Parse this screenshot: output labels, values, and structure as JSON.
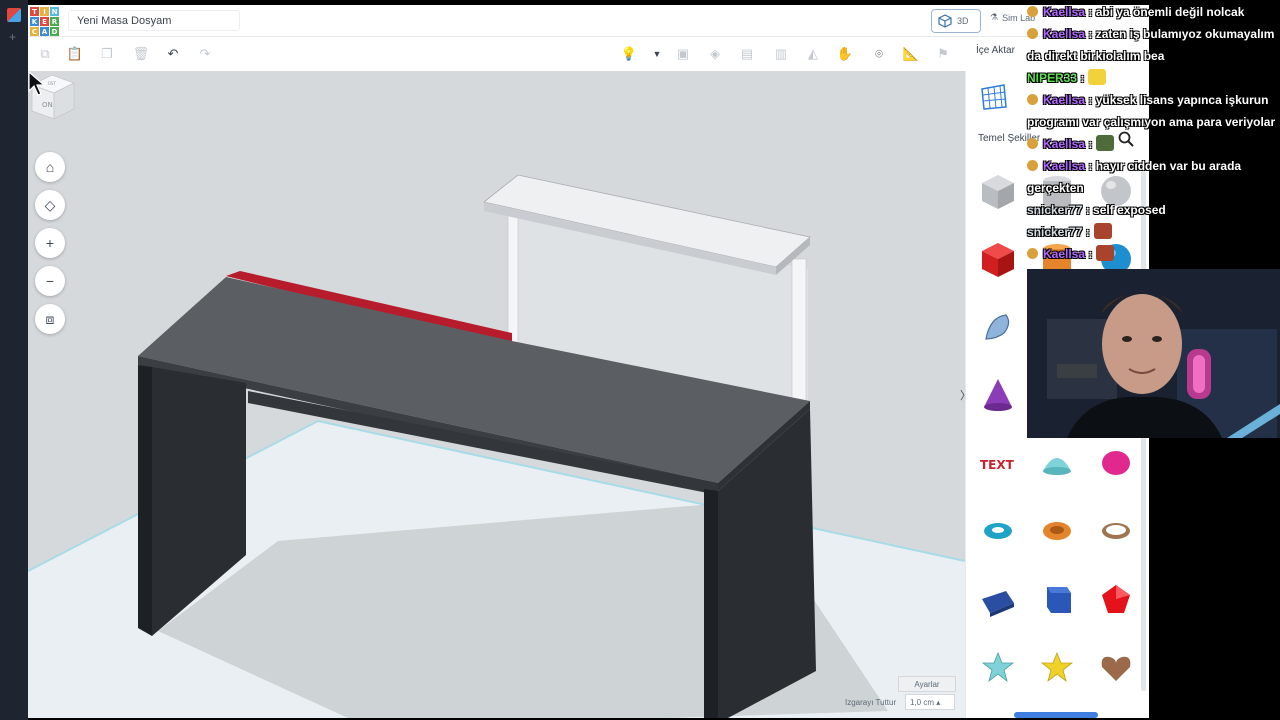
{
  "app": {
    "logo_letters": [
      "T",
      "I",
      "N",
      "K",
      "E",
      "R",
      "C",
      "A",
      "D"
    ],
    "logo_colors": [
      "#e0473e",
      "#e5b03b",
      "#54b7e6",
      "#3c8dd0",
      "#e0473e",
      "#4cab52",
      "#e5b03b",
      "#3c8dd0",
      "#4cab52"
    ],
    "doc_title": "Yeni Masa Dosyam",
    "mode_3d_label": "3D",
    "simlab_label": "Sim Lab",
    "import_label": "İçe Aktar"
  },
  "toolbar": {
    "icons": [
      "copy-icon",
      "paste-icon",
      "duplicate-icon",
      "delete-icon",
      "undo-icon",
      "redo-icon",
      "light-icon",
      "chevron-down-icon",
      "group-icon",
      "ungroup-icon",
      "align-icon",
      "mirror-icon",
      "cruise-icon",
      "workplane-icon",
      "ruler-icon",
      "notes-icon"
    ]
  },
  "viewport": {
    "viewcube_face": "ON",
    "viewcube_top": "ÜST",
    "settings_label": "Ayarlar",
    "snap_label": "Izgarayı Tuttur",
    "snap_value": "1,0 cm",
    "colors": {
      "floor": "#d6d9dc",
      "grid": "#e8f0f3",
      "desk_top": "#55595d",
      "desk_leg": "#272b2f",
      "accent": "#b71c2c",
      "shelf": "#e4e7ea"
    }
  },
  "panel": {
    "category_label": "Temel Şekiller",
    "shapes": [
      "box-striped",
      "cylinder-striped",
      "sphere-striped",
      "box",
      "cylinder",
      "sphere",
      "scribble",
      "pyramid",
      "roof",
      "cone",
      "round-roof",
      "half-sphere",
      "text",
      "paraboloid",
      "polygon",
      "torus",
      "tube",
      "ring",
      "wedge",
      "hexagonal-prism",
      "gem",
      "star",
      "star-gold",
      "heart"
    ]
  },
  "chat": {
    "lines": [
      {
        "user": "Kaellsa",
        "text": " : abi ya önemli değil nolcak",
        "badge": true
      },
      {
        "user": "Kaellsa",
        "text": " : zaten iş bulamıyoz okumayalım",
        "badge": true
      },
      {
        "user": "",
        "text": "da direkt birkiolalım bea",
        "badge": false
      },
      {
        "user": "NIPER33",
        "text": " :",
        "badge": false,
        "emote": "#f2d23a",
        "green": true
      },
      {
        "user": "Kaellsa",
        "text": " : yüksek lisans yapınca işkurun",
        "badge": true
      },
      {
        "user": "",
        "text": "programı var çalışmıyon ama para veriyolar",
        "badge": false
      },
      {
        "user": "Kaellsa",
        "text": " :",
        "badge": true,
        "emote": "#4f6b3a"
      },
      {
        "user": "Kaellsa",
        "text": " : hayır cidden var bu arada",
        "badge": true
      },
      {
        "user": "",
        "text": "gerçekten",
        "badge": false
      },
      {
        "user": "snicker77",
        "text": " : self exposed",
        "badge": false,
        "grey": true
      },
      {
        "user": "snicker77",
        "text": " :",
        "badge": false,
        "grey": true,
        "emote": "#a8432e"
      },
      {
        "user": "Kaellsa",
        "text": " :",
        "badge": true,
        "emote": "#a8432e"
      }
    ]
  }
}
